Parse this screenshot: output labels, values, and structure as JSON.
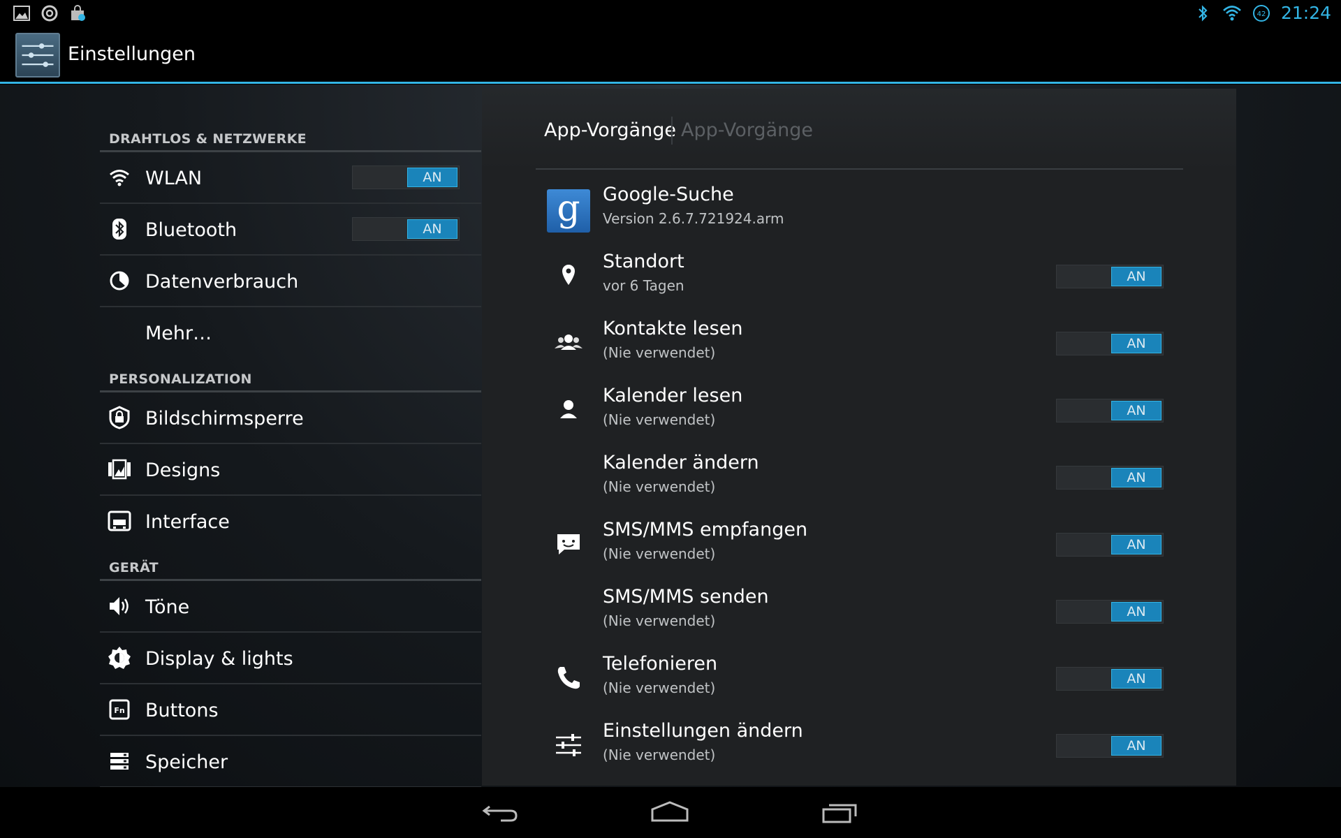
{
  "statusbar": {
    "left_icons": [
      "gallery-icon",
      "sync-icon",
      "store-icon"
    ],
    "right_icons": [
      "bluetooth-icon",
      "wifi-icon",
      "battery-icon"
    ],
    "battery_level": "42",
    "time": "21:24",
    "accent": "#33b5e5"
  },
  "actionbar": {
    "title": "Einstellungen",
    "icon": "settings-sliders-icon"
  },
  "sections": {
    "wireless": "DRAHTLOS & NETZWERKE",
    "personal": "PERSONALIZATION",
    "device": "GERÄT"
  },
  "left_items": [
    {
      "label": "WLAN",
      "icon": "wifi-icon",
      "switch": "AN"
    },
    {
      "label": "Bluetooth",
      "icon": "bluetooth-icon",
      "switch": "AN"
    },
    {
      "label": "Datenverbrauch",
      "icon": "data-usage-icon"
    },
    {
      "label": "Mehr…",
      "icon": ""
    },
    {
      "label": "Bildschirmsperre",
      "icon": "lock-icon"
    },
    {
      "label": "Designs",
      "icon": "themes-icon"
    },
    {
      "label": "Interface",
      "icon": "interface-icon"
    },
    {
      "label": "Töne",
      "icon": "volume-icon"
    },
    {
      "label": "Display & lights",
      "icon": "brightness-icon"
    },
    {
      "label": "Buttons",
      "icon": "fn-key-icon"
    },
    {
      "label": "Speicher",
      "icon": "storage-icon"
    }
  ],
  "right": {
    "tab_active": "App-Vorgänge",
    "tab_inactive": "App-Vorgänge",
    "app": {
      "name": "Google-Suche",
      "version": "Version 2.6.7.721924.arm",
      "icon": "google-search-icon"
    },
    "ops": [
      {
        "title": "Standort",
        "subtitle": "vor 6 Tagen",
        "icon": "location-pin-icon",
        "switch": "AN"
      },
      {
        "title": "Kontakte lesen",
        "subtitle": "(Nie verwendet)",
        "icon": "contacts-icon",
        "switch": "AN"
      },
      {
        "title": "Kalender lesen",
        "subtitle": "(Nie verwendet)",
        "icon": "person-icon",
        "switch": "AN"
      },
      {
        "title": "Kalender ändern",
        "subtitle": "(Nie verwendet)",
        "icon": "",
        "switch": "AN"
      },
      {
        "title": "SMS/MMS empfangen",
        "subtitle": "(Nie verwendet)",
        "icon": "message-icon",
        "switch": "AN"
      },
      {
        "title": "SMS/MMS senden",
        "subtitle": "(Nie verwendet)",
        "icon": "",
        "switch": "AN"
      },
      {
        "title": "Telefonieren",
        "subtitle": "(Nie verwendet)",
        "icon": "phone-icon",
        "switch": "AN"
      },
      {
        "title": "Einstellungen ändern",
        "subtitle": "(Nie verwendet)",
        "icon": "settings-sliders-icon",
        "switch": "AN"
      }
    ]
  },
  "navbar": {
    "buttons": [
      "back-icon",
      "home-icon",
      "recents-icon"
    ]
  }
}
